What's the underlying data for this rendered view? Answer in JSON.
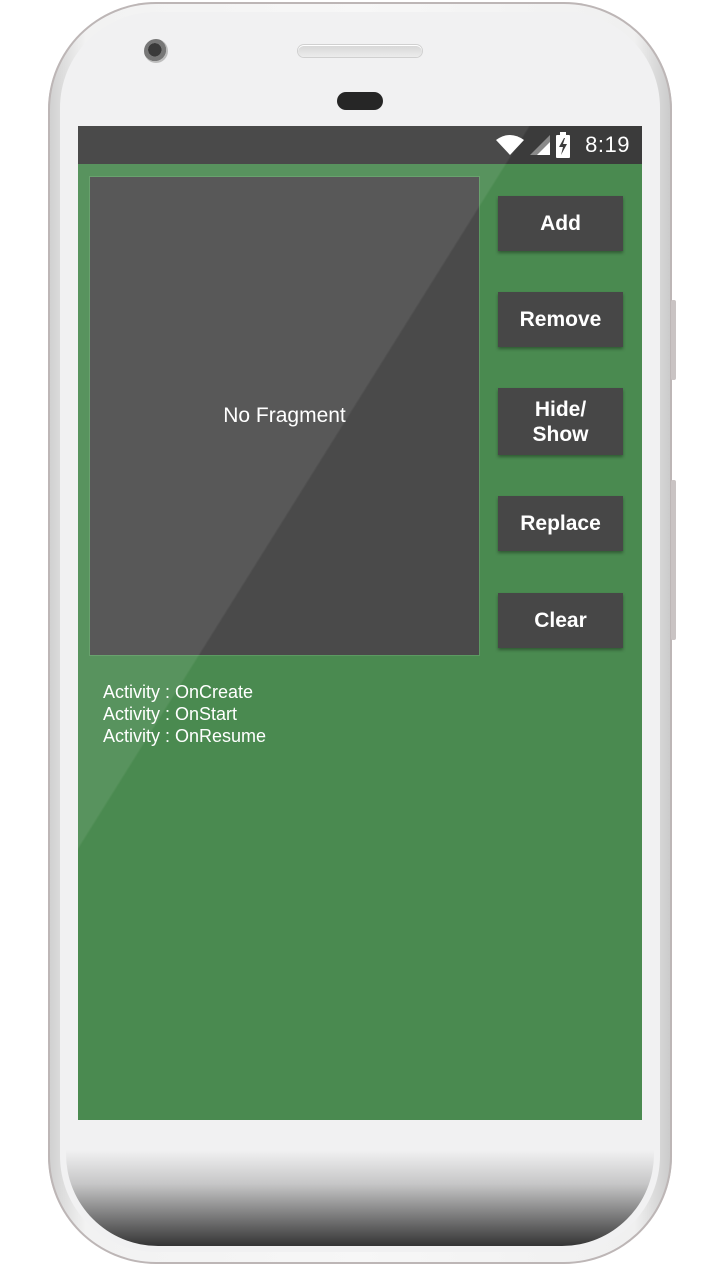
{
  "status_bar": {
    "time": "8:19",
    "icons": [
      "wifi-icon",
      "cellular-signal-icon",
      "battery-charging-icon"
    ]
  },
  "fragment_area": {
    "placeholder": "No Fragment"
  },
  "buttons": {
    "add": "Add",
    "remove": "Remove",
    "hide_show": "Hide/\nShow",
    "replace": "Replace",
    "clear": "Clear"
  },
  "log": [
    "Activity : OnCreate",
    "Activity : OnStart",
    "Activity : OnResume"
  ],
  "colors": {
    "screen_background": "#4a8a50",
    "fragment_background": "#4a4a4a",
    "button_background": "#474747",
    "status_bar_background": "#3b3b3b"
  }
}
